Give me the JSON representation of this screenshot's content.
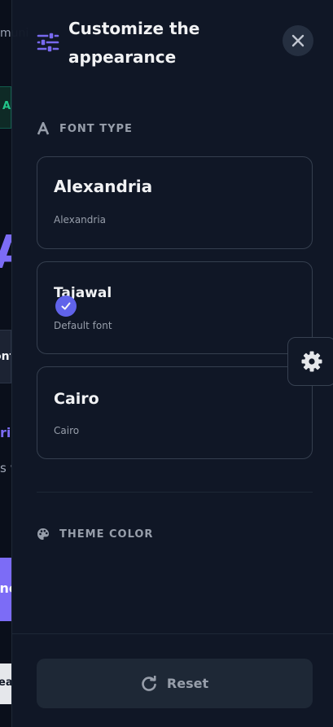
{
  "background": {
    "top_text": "muni",
    "tag_text": "Av",
    "logo_text": "A",
    "role_text": "ontend Developer",
    "purple_text": "rie",
    "grey_text": "s with the latest",
    "cta_text": "ince",
    "bottom_text": "ea"
  },
  "drawer": {
    "title": "Customize the appearance",
    "font_section": {
      "heading": "FONT TYPE",
      "options": [
        {
          "name": "Alexandria",
          "subtitle": "Alexandria",
          "selected": false
        },
        {
          "name": "Tajawal",
          "subtitle": "Default font",
          "selected": true
        },
        {
          "name": "Cairo",
          "subtitle": "Cairo",
          "selected": false
        }
      ]
    },
    "theme_section": {
      "heading": "THEME COLOR"
    },
    "reset_label": "Reset"
  },
  "colors": {
    "accent": "#6366f1",
    "panel": "#111827",
    "text_muted": "#9ca3af"
  }
}
